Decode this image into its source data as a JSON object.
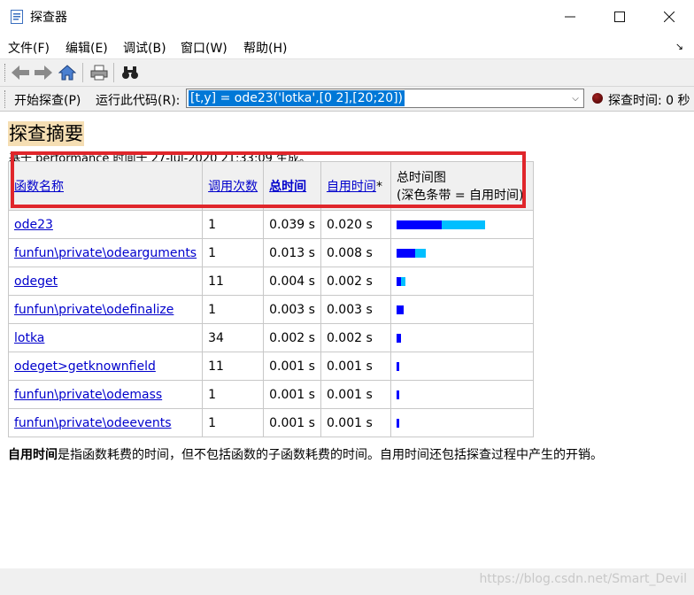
{
  "window": {
    "title": "探查器"
  },
  "menu": [
    "文件(F)",
    "编辑(E)",
    "调试(B)",
    "窗口(W)",
    "帮助(H)"
  ],
  "runbar": {
    "start_label": "开始探查(P)",
    "run_label": "运行此代码(R):",
    "code": "[t,y] = ode23('lotka',[0 2],[20;20])",
    "time_label": "探查时间: 0 秒"
  },
  "summary": {
    "title": "探查摘要",
    "generated_text": "基于 performance 时间于 27-Jul-2020 21:33:09 生成。"
  },
  "table": {
    "headers": {
      "name": "函数名称",
      "calls": "调用次数",
      "total": "总时间",
      "self": "自用时间",
      "self_star": "*",
      "plot_line1": "总时间图",
      "plot_line2": "(深色条带 = 自用时间)"
    },
    "rows": [
      {
        "name": "ode23",
        "calls": "1",
        "total": "0.039 s",
        "self": "0.020 s",
        "total_val": 0.039,
        "self_val": 0.02
      },
      {
        "name": "funfun\\private\\odearguments",
        "calls": "1",
        "total": "0.013 s",
        "self": "0.008 s",
        "total_val": 0.013,
        "self_val": 0.008
      },
      {
        "name": "odeget",
        "calls": "11",
        "total": "0.004 s",
        "self": "0.002 s",
        "total_val": 0.004,
        "self_val": 0.002
      },
      {
        "name": "funfun\\private\\odefinalize",
        "calls": "1",
        "total": "0.003 s",
        "self": "0.003 s",
        "total_val": 0.003,
        "self_val": 0.003
      },
      {
        "name": "lotka",
        "calls": "34",
        "total": "0.002 s",
        "self": "0.002 s",
        "total_val": 0.002,
        "self_val": 0.002
      },
      {
        "name": "odeget>getknownfield",
        "calls": "11",
        "total": "0.001 s",
        "self": "0.001 s",
        "total_val": 0.001,
        "self_val": 0.001
      },
      {
        "name": "funfun\\private\\odemass",
        "calls": "1",
        "total": "0.001 s",
        "self": "0.001 s",
        "total_val": 0.001,
        "self_val": 0.001
      },
      {
        "name": "funfun\\private\\odeevents",
        "calls": "1",
        "total": "0.001 s",
        "self": "0.001 s",
        "total_val": 0.001,
        "self_val": 0.001
      }
    ]
  },
  "footnote": {
    "bold": "自用时间",
    "text": "是指函数耗费的时间，但不包括函数的子函数耗费的时间。自用时间还包括探查过程中产生的开销。"
  },
  "watermark": "https://blog.csdn.net/Smart_Devil",
  "colors": {
    "self_bar": "#0000ff",
    "total_bar": "#00bfff",
    "highlight_box": "#e0262b",
    "title_bg": "#f5deb3"
  }
}
